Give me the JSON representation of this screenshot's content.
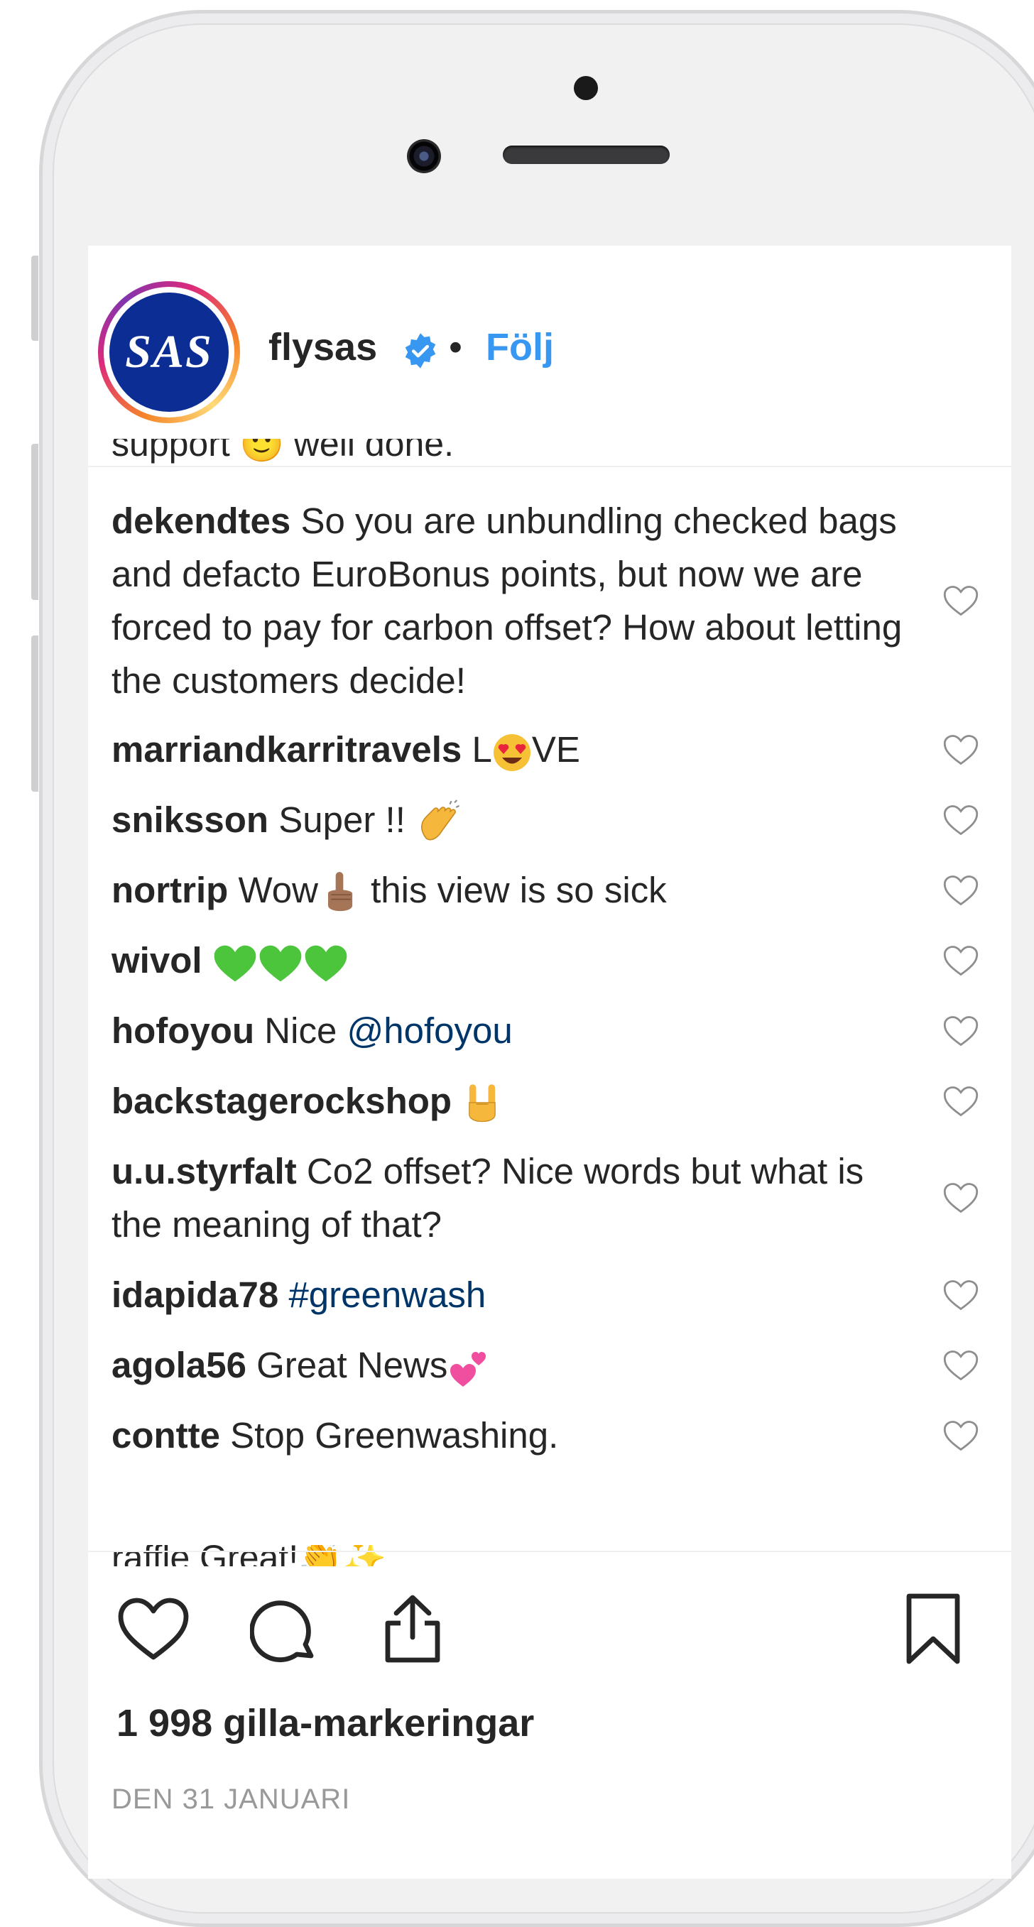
{
  "post": {
    "avatar_text": "SAS",
    "username": "flysas",
    "separator": "•",
    "follow_label": "Följ",
    "top_cutoff_text": "support 🙂 well done.",
    "bottom_cutoff_text": "raffle Great!👏✨"
  },
  "comments": [
    {
      "user": "dekendtes",
      "text": "So you are unbundling checked bags and defacto EuroBonus points, but now we are forced to pay for carbon offset? How about letting the customers decide!"
    },
    {
      "user": "marriandkarritravels",
      "text_before": "L",
      "emoji": "heart-eyes-emoji",
      "text_after": "VE"
    },
    {
      "user": "sniksson",
      "text_before": "Super !!",
      "emoji": "clapping-hands-emoji",
      "text_after": ""
    },
    {
      "user": "nortrip",
      "text_before": "Wow",
      "emoji": "index-pointing-up-emoji",
      "text_after": "this view is so sick"
    },
    {
      "user": "wivol",
      "emoji_count": 3,
      "emoji": "green-heart-emoji"
    },
    {
      "user": "hofoyou",
      "text_before": "Nice",
      "mention": "@hofoyou"
    },
    {
      "user": "backstagerockshop",
      "emoji": "rock-on-hand-emoji"
    },
    {
      "user": "u.u.styrfalt",
      "text": "Co2 offset? Nice words but what is the meaning of that?"
    },
    {
      "user": "idapida78",
      "hashtag": "#greenwash"
    },
    {
      "user": "agola56",
      "text_before": "Great News",
      "emoji": "two-hearts-emoji"
    },
    {
      "user": "contte",
      "text": "Stop Greenwashing."
    }
  ],
  "actions": {
    "like_icon": "heart-outline-icon",
    "comment_icon": "comment-bubble-icon",
    "share_icon": "share-upload-icon",
    "save_icon": "bookmark-icon"
  },
  "likes_text": "1 998 gilla-markeringar",
  "date_text": "DEN 31 JANUARI",
  "colors": {
    "follow_blue": "#3897f0",
    "link_blue": "#003569",
    "text": "#262626",
    "muted": "#999999",
    "sas_blue": "#0b2d94"
  }
}
